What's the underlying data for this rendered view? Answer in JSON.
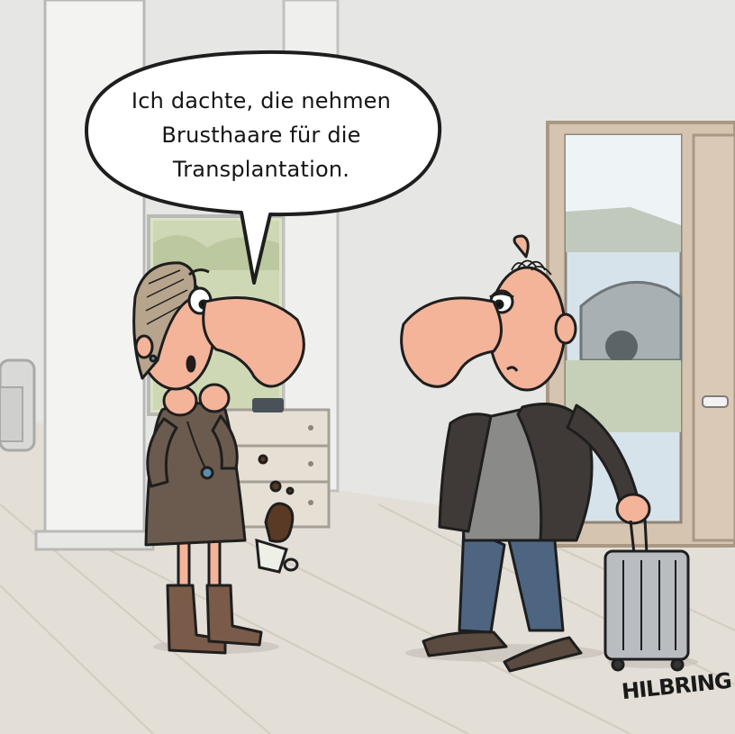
{
  "speech_bubble": {
    "lines": [
      "Ich dachte, die nehmen",
      "Brusthaare für die",
      "Transplantation."
    ]
  },
  "signature": "HILBRING",
  "colors": {
    "wall": "#e6e6e4",
    "floor": "#e2ddd5",
    "skin": "#f3b49a",
    "outline": "#1e1e1e",
    "woman_dress": "#6b5b4e",
    "boots": "#7a5a48",
    "man_jacket": "#3f3a38",
    "man_shirt": "#8a8a88",
    "man_pants": "#4d6580",
    "suitcase": "#b9bcc0",
    "coffee": "#5a3a24"
  }
}
